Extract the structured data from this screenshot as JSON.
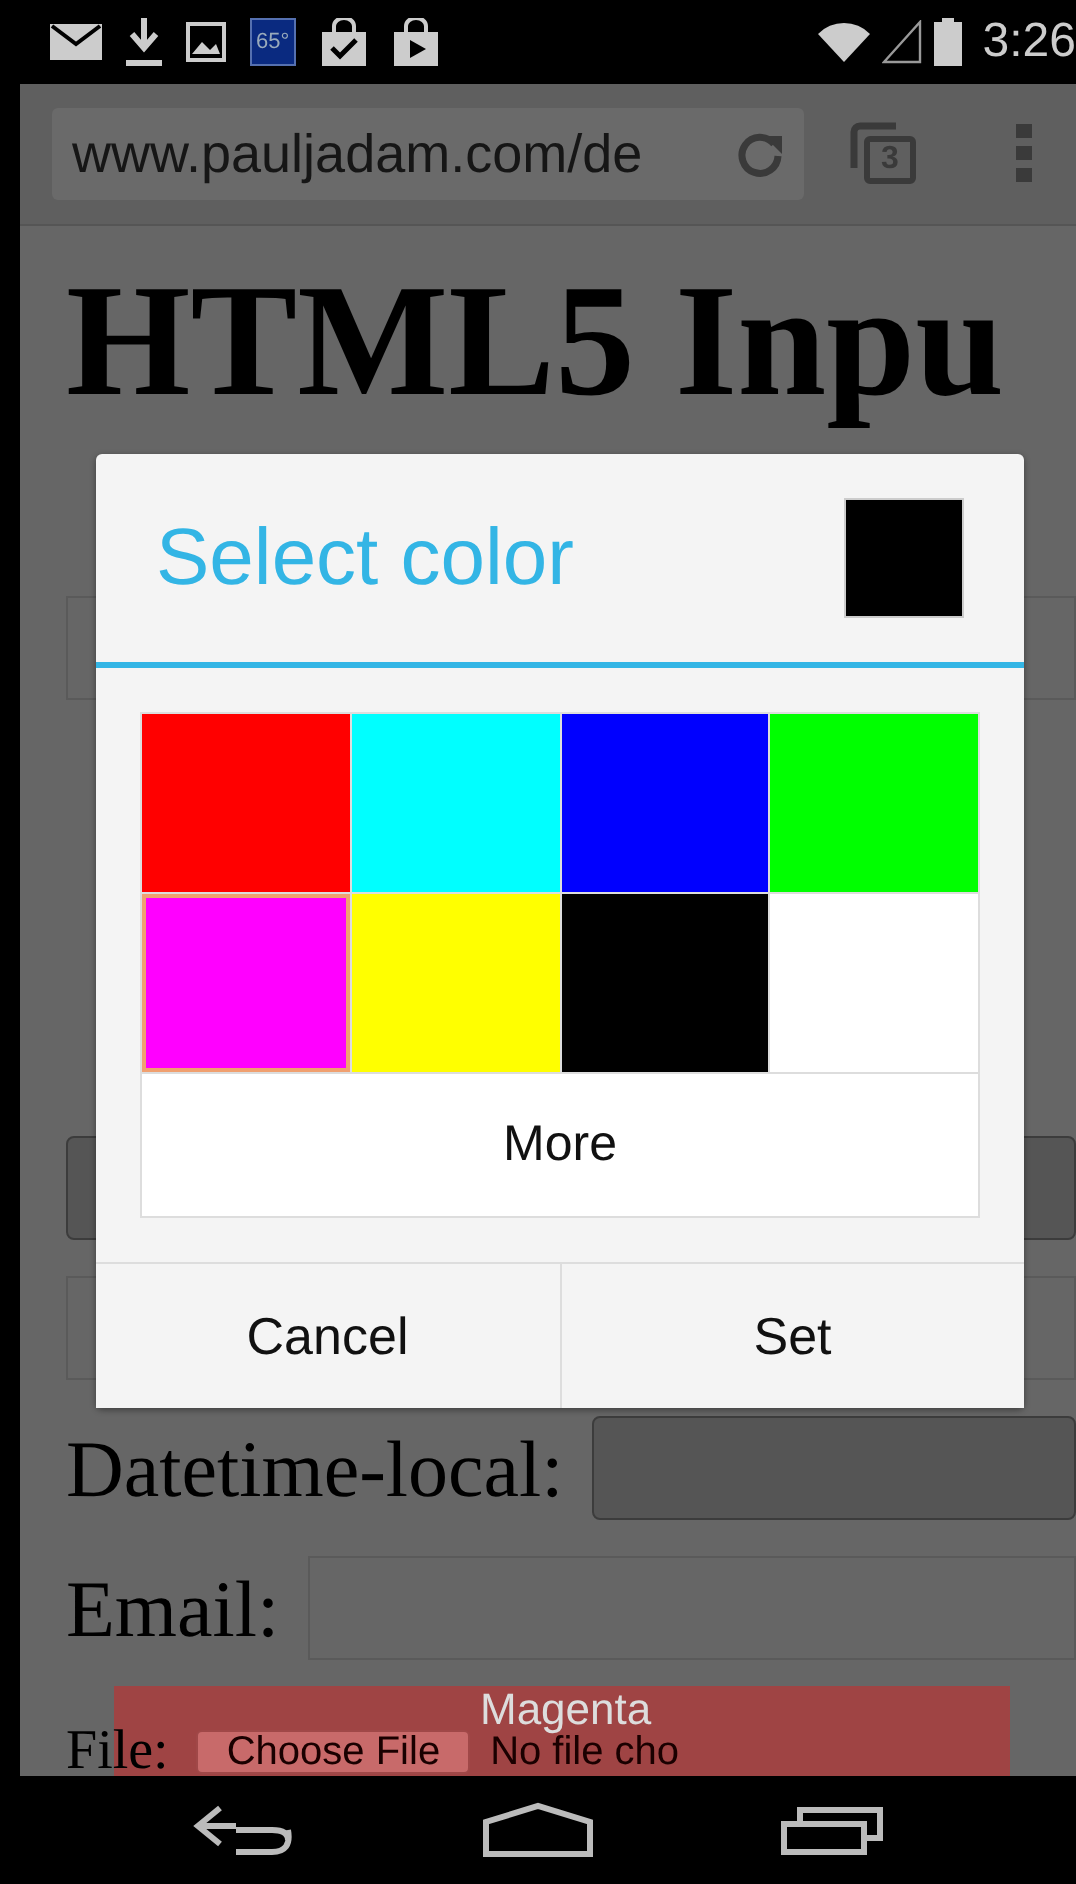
{
  "status_bar": {
    "weather_badge": "65°",
    "time": "3:26"
  },
  "browser": {
    "url": "www.pauljadam.com/de",
    "tab_count": "3"
  },
  "page": {
    "heading": "HTML5 Inpu",
    "rows": [
      {
        "kind": "text"
      },
      {
        "kind": "button"
      },
      {
        "kind": "text"
      },
      {
        "lines": [
          "Datetime-local:"
        ],
        "kind": "button"
      },
      {
        "lines": [
          "Email:"
        ],
        "kind": "text"
      },
      {
        "lines": [
          "File:"
        ],
        "kind": "file",
        "button": "Choose File",
        "status": "No file cho"
      }
    ]
  },
  "dialog": {
    "title": "Select color",
    "swatches": [
      {
        "color": "#ff0000",
        "selected": false
      },
      {
        "color": "#00ffff",
        "selected": false
      },
      {
        "color": "#0000ff",
        "selected": false
      },
      {
        "color": "#00ff00",
        "selected": false
      },
      {
        "color": "#ff00ff",
        "selected": true
      },
      {
        "color": "#ffff00",
        "selected": false
      },
      {
        "color": "#000000",
        "selected": false
      },
      {
        "color": "#ffffff",
        "selected": false
      }
    ],
    "more": "More",
    "buttons": [
      "Cancel",
      "Set"
    ]
  },
  "toast": "Magenta"
}
